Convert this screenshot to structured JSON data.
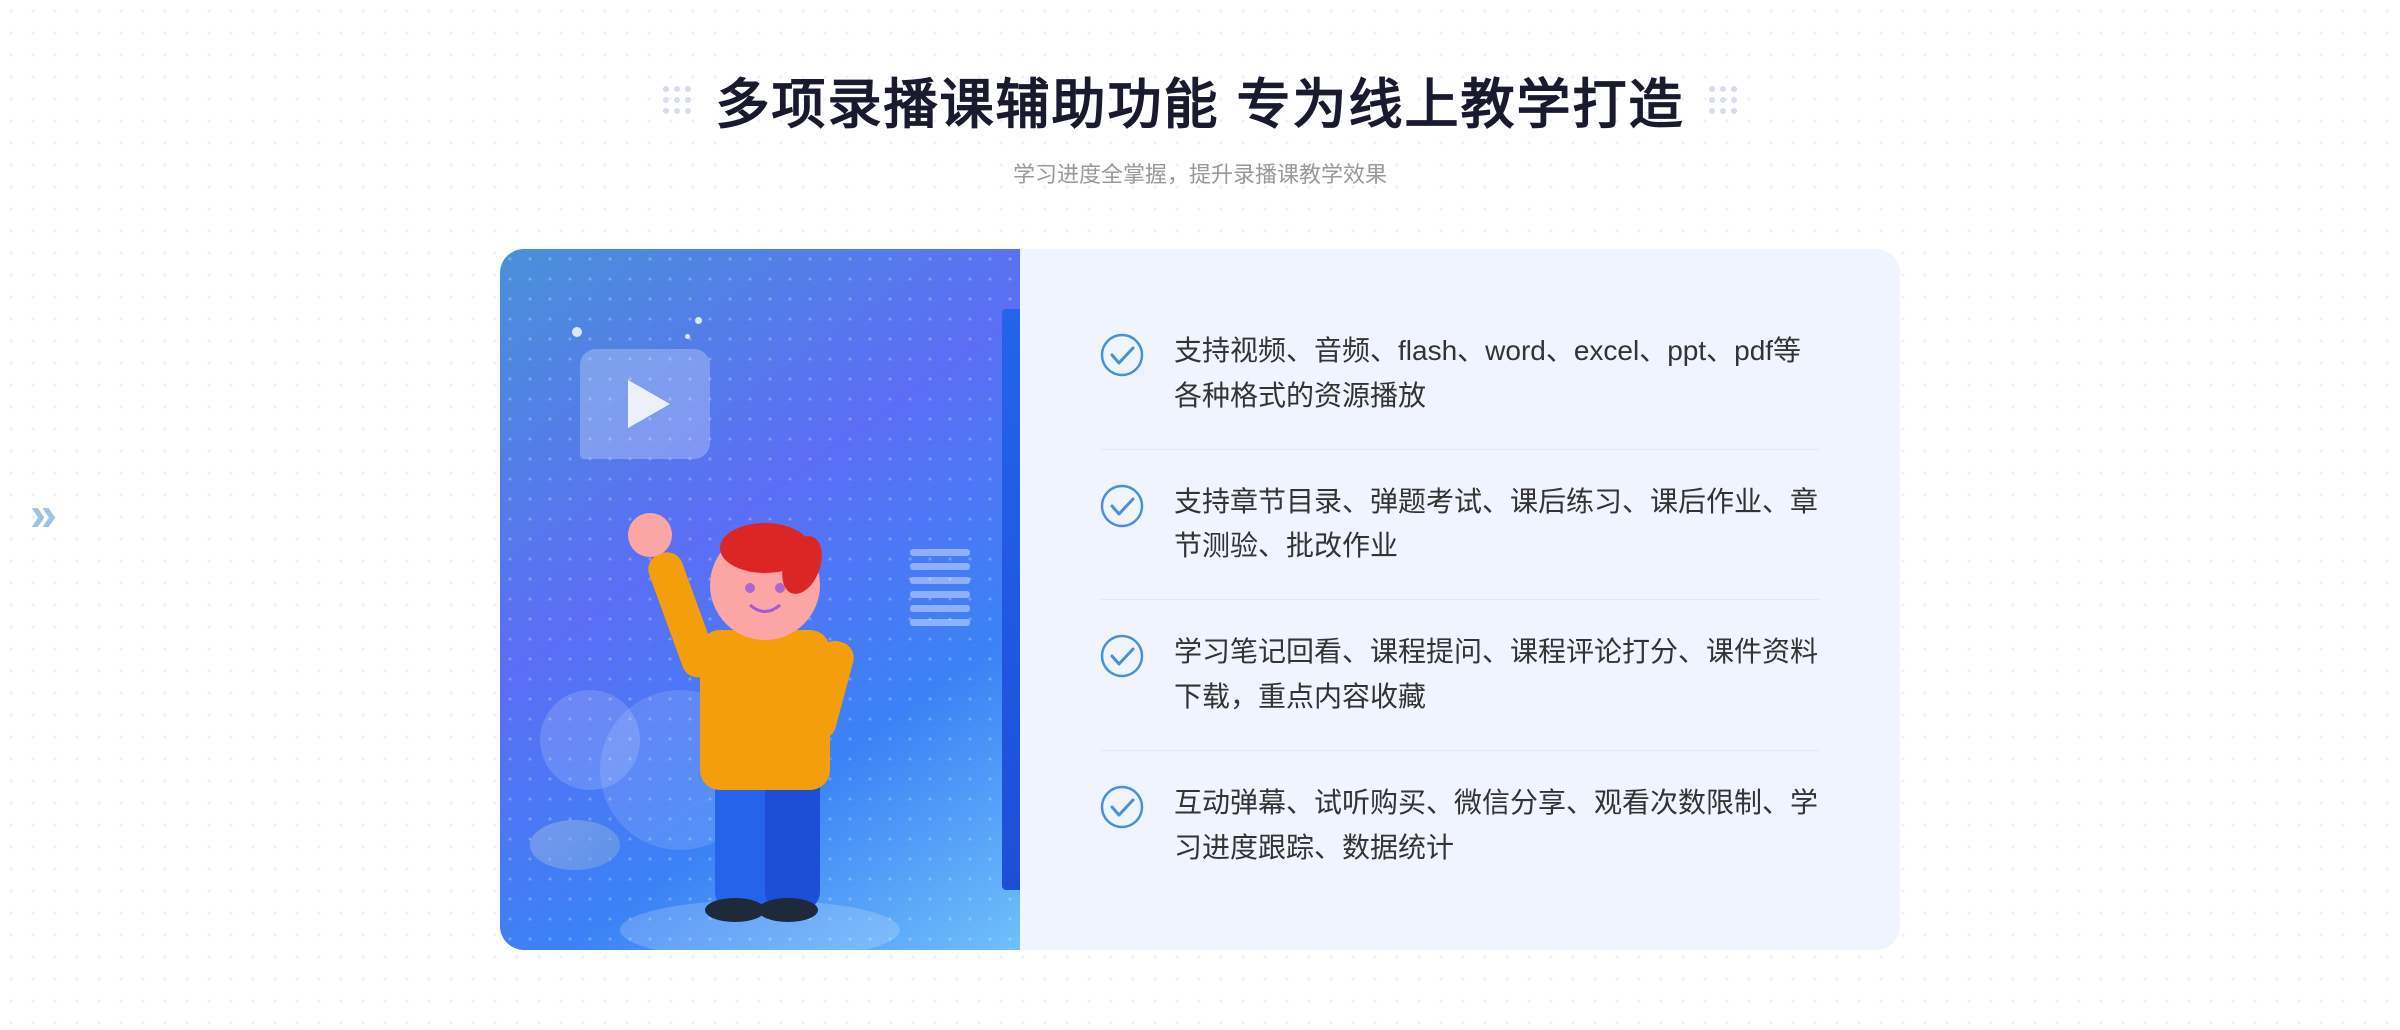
{
  "header": {
    "title": "多项录播课辅助功能 专为线上教学打造",
    "subtitle": "学习进度全掌握，提升录播课教学效果"
  },
  "decorative": {
    "left_arrow": "»"
  },
  "features": [
    {
      "id": 1,
      "text": "支持视频、音频、flash、word、excel、ppt、pdf等各种格式的资源播放"
    },
    {
      "id": 2,
      "text": "支持章节目录、弹题考试、课后练习、课后作业、章节测验、批改作业"
    },
    {
      "id": 3,
      "text": "学习笔记回看、课程提问、课程评论打分、课件资料下载，重点内容收藏"
    },
    {
      "id": 4,
      "text": "互动弹幕、试听购买、微信分享、观看次数限制、学习进度跟踪、数据统计"
    }
  ]
}
